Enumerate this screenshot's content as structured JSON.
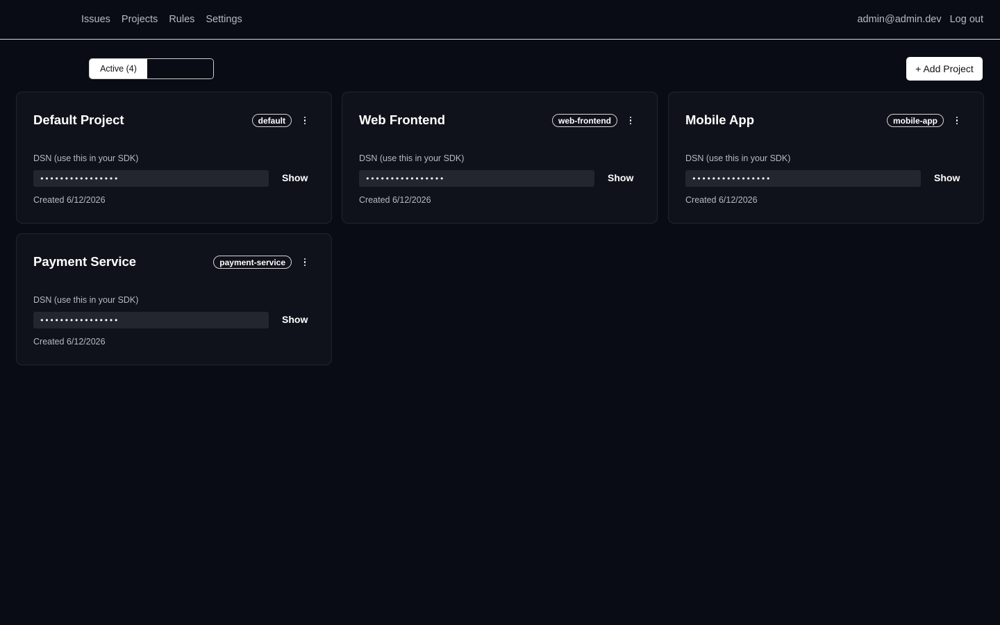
{
  "nav": {
    "items": [
      "Issues",
      "Projects",
      "Rules",
      "Settings"
    ]
  },
  "user": {
    "email": "admin@admin.dev",
    "logout_label": "Log out"
  },
  "filter": {
    "active_label": "Active (4)",
    "other_label": ""
  },
  "toolbar": {
    "add_label": "+ Add Project"
  },
  "projects": [
    {
      "name": "Default Project",
      "slug": "default",
      "dsn_label": "DSN (use this in your SDK)",
      "dsn_masked": "••••••••••••••••",
      "show_label": "Show",
      "created": "Created 6/12/2026"
    },
    {
      "name": "Web Frontend",
      "slug": "web-frontend",
      "dsn_label": "DSN (use this in your SDK)",
      "dsn_masked": "••••••••••••••••",
      "show_label": "Show",
      "created": "Created 6/12/2026"
    },
    {
      "name": "Mobile App",
      "slug": "mobile-app",
      "dsn_label": "DSN (use this in your SDK)",
      "dsn_masked": "••••••••••••••••",
      "show_label": "Show",
      "created": "Created 6/12/2026"
    },
    {
      "name": "Payment Service",
      "slug": "payment-service",
      "dsn_label": "DSN (use this in your SDK)",
      "dsn_masked": "••••••••••••••••",
      "show_label": "Show",
      "created": "Created 6/12/2026"
    }
  ],
  "colors": {
    "background": "#090c14",
    "card": "#0f121a",
    "muted_text": "#b7bac2",
    "field": "#23262f"
  },
  "icons": {
    "card_menu": "more-vertical-icon"
  }
}
